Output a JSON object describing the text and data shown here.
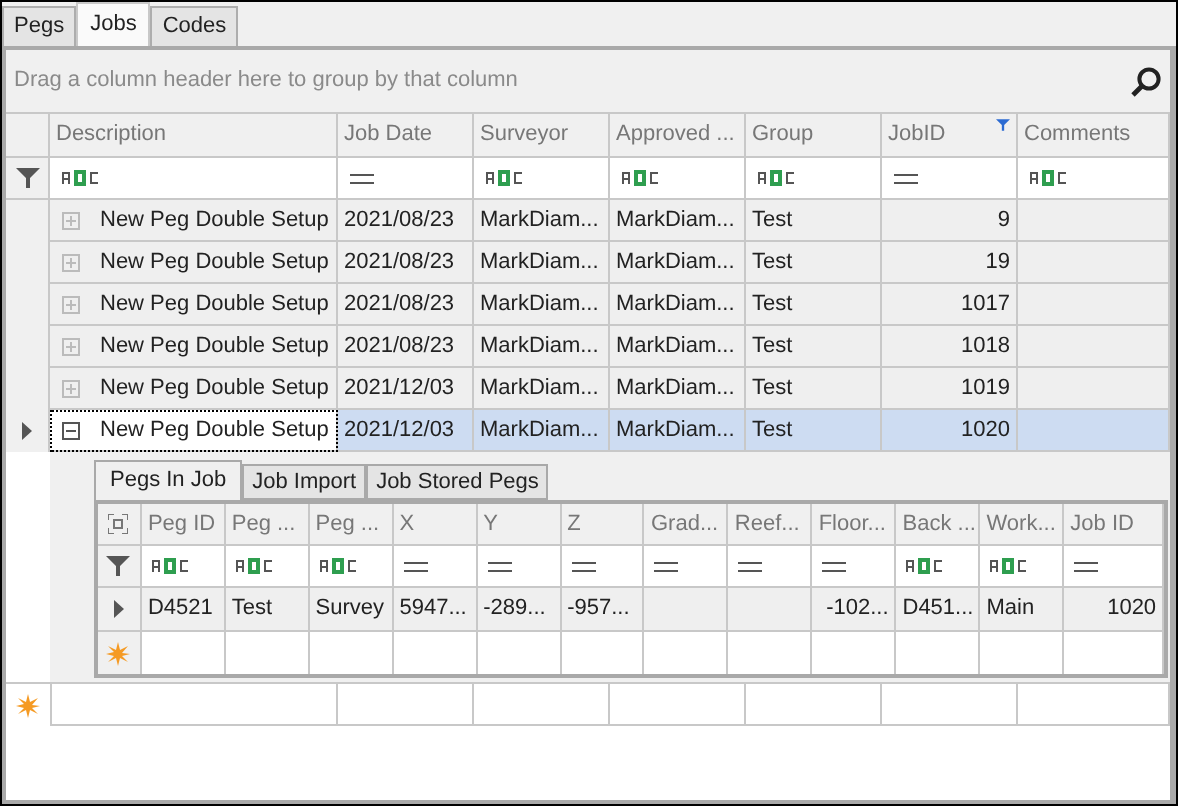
{
  "tabs": [
    {
      "label": "Pegs",
      "selected": false
    },
    {
      "label": "Jobs",
      "selected": true
    },
    {
      "label": "Codes",
      "selected": false
    }
  ],
  "group_panel": {
    "hint": "Drag a column header here to group by that column"
  },
  "columns": [
    {
      "label": "Description",
      "kind": "text",
      "filtered": false,
      "numeric": false
    },
    {
      "label": "Job Date",
      "kind": "equals",
      "filtered": false,
      "numeric": false
    },
    {
      "label": "Surveyor",
      "kind": "text",
      "filtered": false,
      "numeric": false
    },
    {
      "label": "Approved ...",
      "kind": "text",
      "filtered": false,
      "numeric": false
    },
    {
      "label": "Group",
      "kind": "text",
      "filtered": false,
      "numeric": false
    },
    {
      "label": "JobID",
      "kind": "equals",
      "filtered": true,
      "numeric": true
    },
    {
      "label": "Comments",
      "kind": "text",
      "filtered": false,
      "numeric": false
    }
  ],
  "rows": [
    {
      "expanded": false,
      "selected": false,
      "cells": [
        "New Peg Double Setup",
        "2021/08/23",
        "MarkDiam...",
        "MarkDiam...",
        "Test",
        "9",
        null
      ]
    },
    {
      "expanded": false,
      "selected": false,
      "cells": [
        "New Peg Double Setup",
        "2021/08/23",
        "MarkDiam...",
        "MarkDiam...",
        "Test",
        "19",
        null
      ]
    },
    {
      "expanded": false,
      "selected": false,
      "cells": [
        "New Peg Double Setup",
        "2021/08/23",
        "MarkDiam...",
        "MarkDiam...",
        "Test",
        "1017",
        null
      ]
    },
    {
      "expanded": false,
      "selected": false,
      "cells": [
        "New Peg Double Setup",
        "2021/08/23",
        "MarkDiam...",
        "MarkDiam...",
        "Test",
        "1018",
        null
      ]
    },
    {
      "expanded": false,
      "selected": false,
      "cells": [
        "New Peg Double Setup",
        "2021/12/03",
        "MarkDiam...",
        "MarkDiam...",
        "Test",
        "1019",
        null
      ]
    },
    {
      "expanded": true,
      "selected": true,
      "cells": [
        "New Peg Double Setup",
        "2021/12/03",
        "MarkDiam...",
        "MarkDiam...",
        "Test",
        "1020",
        null
      ]
    }
  ],
  "detail": {
    "tabs": [
      {
        "label": "Pegs In Job",
        "selected": true
      },
      {
        "label": "Job Import",
        "selected": false
      },
      {
        "label": "Job Stored Pegs",
        "selected": false
      }
    ],
    "columns": [
      {
        "label": "Peg ID",
        "kind": "text",
        "numeric": false
      },
      {
        "label": "Peg ...",
        "kind": "text",
        "numeric": false
      },
      {
        "label": "Peg ...",
        "kind": "text",
        "numeric": false
      },
      {
        "label": "X",
        "kind": "equals",
        "numeric": false
      },
      {
        "label": "Y",
        "kind": "equals",
        "numeric": false
      },
      {
        "label": "Z",
        "kind": "equals",
        "numeric": false
      },
      {
        "label": "Grad...",
        "kind": "equals"
      },
      {
        "label": "Reef...",
        "kind": "equals"
      },
      {
        "label": "Floor...",
        "kind": "equals",
        "numeric": true
      },
      {
        "label": "Back ...",
        "kind": "text",
        "numeric": false
      },
      {
        "label": "Work...",
        "kind": "text",
        "numeric": false
      },
      {
        "label": "Job ID",
        "kind": "equals",
        "numeric": true
      }
    ],
    "rows": [
      {
        "selected": false,
        "cells": [
          "D4521",
          "Test",
          "Survey",
          "5947...",
          "-289...",
          "-957...",
          null,
          null,
          "-102...",
          "D451...",
          "Main",
          "1020"
        ]
      }
    ]
  }
}
